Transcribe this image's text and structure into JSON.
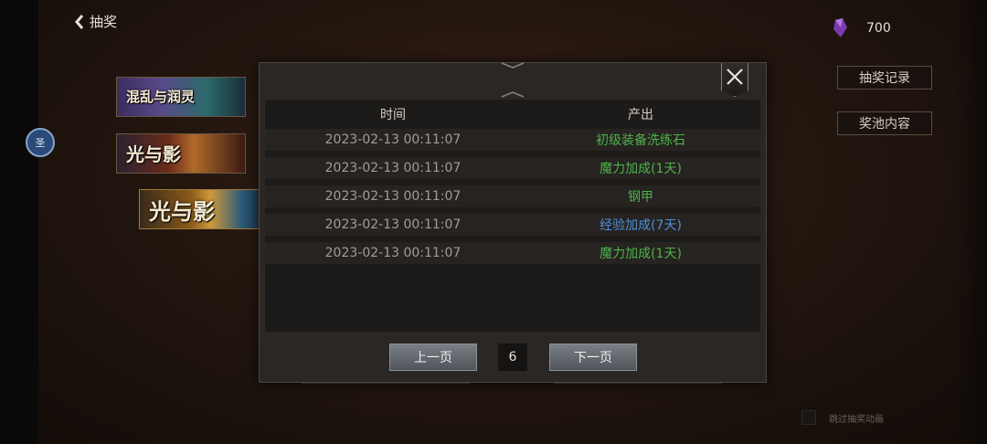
{
  "header": {
    "back_label": "抽奖",
    "currency_amount": "700"
  },
  "side_buttons": {
    "records": "抽奖记录",
    "pool": "奖池内容"
  },
  "banners": [
    {
      "title": "混乱与润灵"
    },
    {
      "title": "光与影"
    },
    {
      "title": "光与影"
    }
  ],
  "left_badge": "圣",
  "skip_animation": "跳过抽奖动画",
  "modal": {
    "columns": {
      "time": "时间",
      "output": "产出"
    },
    "rows": [
      {
        "time": "2023-02-13 00:11:07",
        "output": "初级装备洗练石",
        "color": "#4fb24a"
      },
      {
        "time": "2023-02-13 00:11:07",
        "output": "魔力加成(1天)",
        "color": "#4fb24a"
      },
      {
        "time": "2023-02-13 00:11:07",
        "output": "钢甲",
        "color": "#4fb24a"
      },
      {
        "time": "2023-02-13 00:11:07",
        "output": "经验加成(7天)",
        "color": "#4d8fd8"
      },
      {
        "time": "2023-02-13 00:11:07",
        "output": "魔力加成(1天)",
        "color": "#4fb24a"
      }
    ],
    "pager": {
      "prev_label": "上一页",
      "page": "6",
      "next_label": "下一页"
    }
  }
}
